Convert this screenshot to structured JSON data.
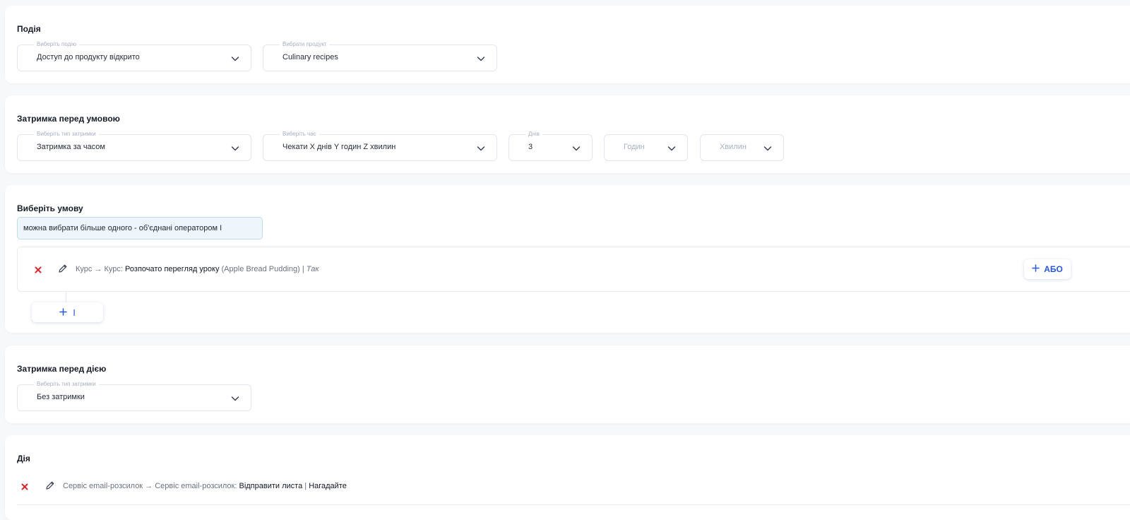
{
  "event": {
    "title": "Подія",
    "event_select": {
      "legend": "Виберіть подію",
      "value": "Доступ до продукту відкрито"
    },
    "product_select": {
      "legend": "Вибрати продукт",
      "value": "Culinary recipes"
    }
  },
  "delay_before_condition": {
    "title": "Затримка перед умовою",
    "type_select": {
      "legend": "Виберіть тип затримки",
      "value": "Затримка за часом"
    },
    "time_select": {
      "legend": "Виберіть час",
      "value": "Чекати X днів Y годин Z хвилин"
    },
    "days_select": {
      "legend": "Днів",
      "value": "3"
    },
    "hours_select": {
      "placeholder": "Годин"
    },
    "minutes_select": {
      "placeholder": "Хвилин"
    }
  },
  "condition": {
    "title": "Виберіть умову",
    "hint": "можна вибрати більше одного - об'єднані оператором І",
    "rule": {
      "source": "Курс → Курс:",
      "action": "Розпочато перегляд уроку",
      "target": "(Apple Bread Pudding)",
      "separator": "|",
      "value": "Так"
    },
    "or_button": "АБО",
    "and_button": "І"
  },
  "delay_before_action": {
    "title": "Затримка перед дією",
    "type_select": {
      "legend": "Виберіть тип затримки",
      "value": "Без затримки"
    }
  },
  "action": {
    "title": "Дія",
    "rule": {
      "source": "Сервіс email-розсилок → Сервіс email-розсилок:",
      "action": "Відправити листа",
      "separator": "|",
      "value": "Нагадайте"
    }
  },
  "colors": {
    "accent": "#2a57d8",
    "danger": "#d9262c",
    "hint_bg": "#eef6fb"
  },
  "icons": {
    "chevron": "chevron-down-icon",
    "delete": "close-icon",
    "edit": "pencil-icon",
    "add": "plus-icon"
  }
}
